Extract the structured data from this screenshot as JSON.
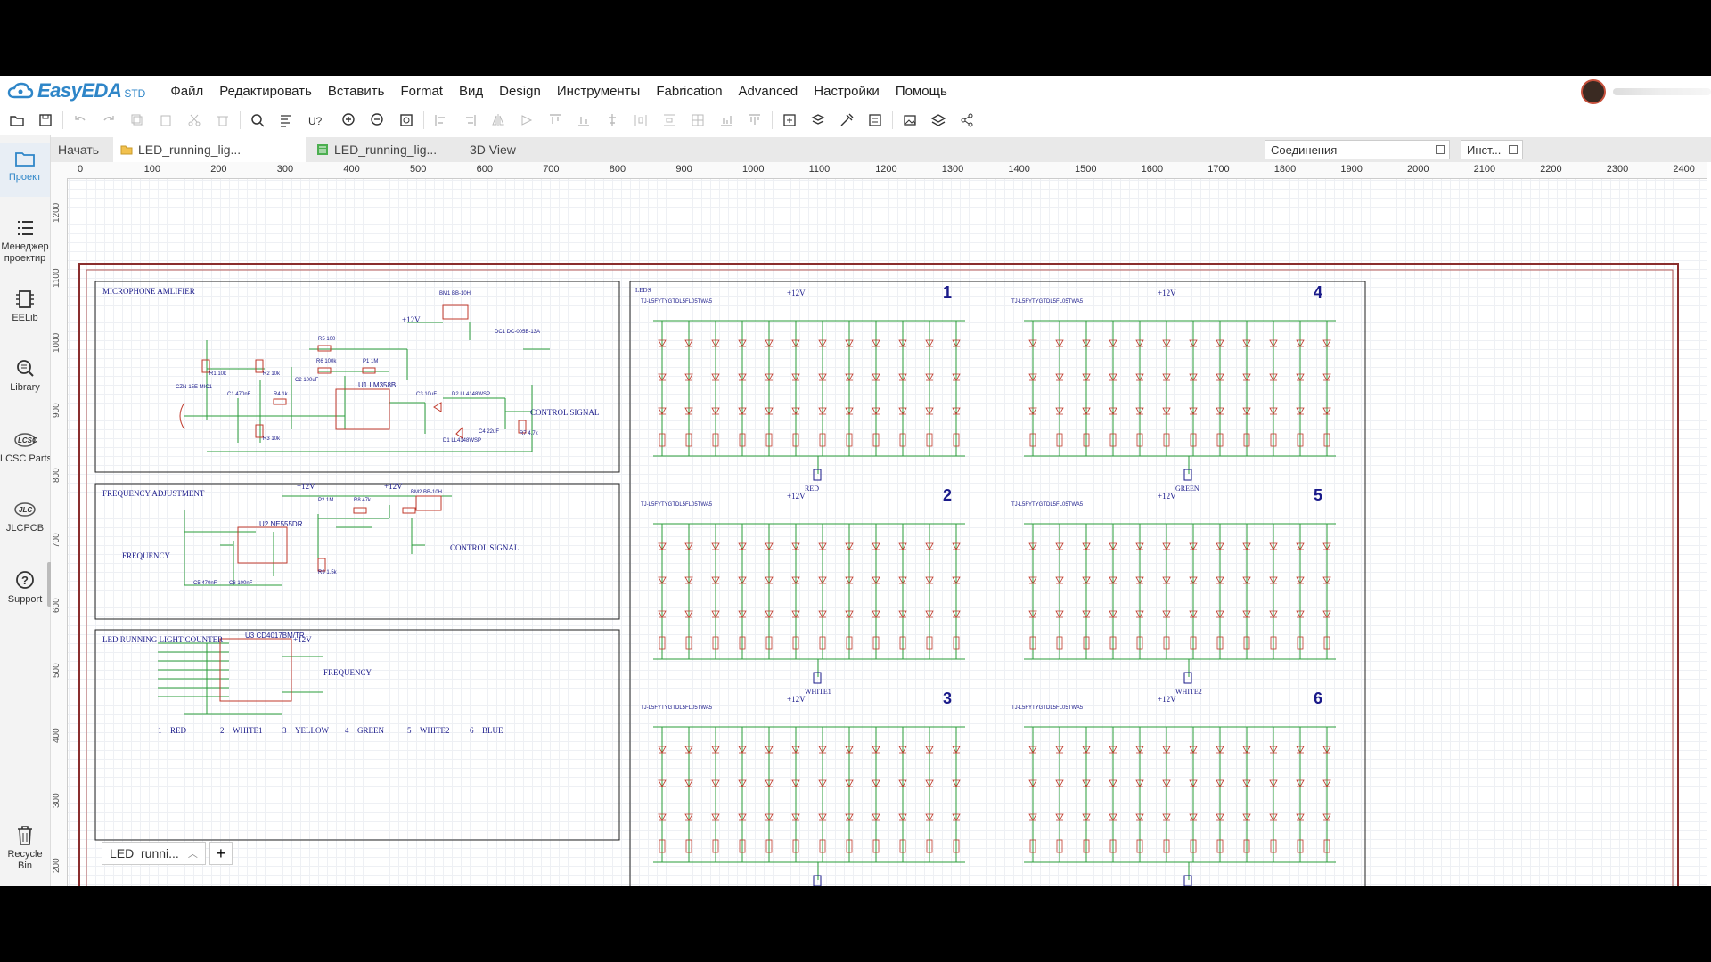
{
  "app": {
    "brand": "EasyEDA",
    "edition": "STD"
  },
  "menu": [
    "Файл",
    "Редактировать",
    "Вставить",
    "Format",
    "Вид",
    "Design",
    "Инструменты",
    "Fabrication",
    "Advanced",
    "Настройки",
    "Помощь"
  ],
  "sidebar": {
    "items": [
      {
        "label": "Проект",
        "icon": "folder-icon"
      },
      {
        "label": "Менеджер проектир",
        "icon": "list-icon"
      },
      {
        "label": "EELib",
        "icon": "component-icon"
      },
      {
        "label": "Library",
        "icon": "search-library-icon"
      },
      {
        "label": "LCSC Parts",
        "icon": "lcsc-icon"
      },
      {
        "label": "JLCPCB",
        "icon": "jlc-icon"
      },
      {
        "label": "Support",
        "icon": "help-icon"
      },
      {
        "label": "Recycle Bin",
        "icon": "trash-icon"
      }
    ]
  },
  "tabs": {
    "start": "Начать",
    "schematic": "LED_running_lig...",
    "pcb": "LED_running_lig...",
    "view3d": "3D View",
    "panel_connections": "Соединения",
    "panel_tools": "Инст..."
  },
  "ruler": {
    "top": [
      "0",
      "100",
      "200",
      "300",
      "400",
      "500",
      "600",
      "700",
      "800",
      "900",
      "1000",
      "1100",
      "1200",
      "1300",
      "1400",
      "1500",
      "1600",
      "1700",
      "1800",
      "1900",
      "2000",
      "2100",
      "2200",
      "2300",
      "2400"
    ],
    "left": [
      "1200",
      "1100",
      "1000",
      "900",
      "800",
      "700",
      "600",
      "500",
      "400",
      "300",
      "200"
    ]
  },
  "schematic": {
    "blocks": {
      "mic": "MICROPHONE AMLIFIER",
      "freq": "FREQUENCY ADJUSTMENT",
      "counter": "LED RUNNING LIGHT COUNTER",
      "leds": "LEDS"
    },
    "nets": {
      "control_signal": "CONTROL SIGNAL",
      "frequency": "FREQUENCY",
      "p12v": "+12V"
    },
    "channels": [
      {
        "num": "1",
        "name": "RED"
      },
      {
        "num": "2",
        "name": "WHITE1"
      },
      {
        "num": "3",
        "name": "YELLOW"
      },
      {
        "num": "4",
        "name": "GREEN"
      },
      {
        "num": "5",
        "name": "WHITE2"
      },
      {
        "num": "6",
        "name": "BLUE"
      }
    ],
    "counter_outputs": [
      {
        "num": "1",
        "name": "RED"
      },
      {
        "num": "2",
        "name": "WHITE1"
      },
      {
        "num": "3",
        "name": "YELLOW"
      },
      {
        "num": "4",
        "name": "GREEN"
      },
      {
        "num": "5",
        "name": "WHITE2"
      },
      {
        "num": "6",
        "name": "BLUE"
      }
    ],
    "chips": {
      "u1": "U1 LM358B",
      "u2": "U2 NE555DR",
      "u3": "U3 CD4017BM/TR"
    },
    "parts": {
      "bm1": "BM1 BB-10H",
      "bm2": "BM2 BB-10H",
      "dc1": "DC1 DC-005B-13A",
      "mic1": "CZN-15E MIC1",
      "d1": "D1 LL4148WSP",
      "d2": "D2 LL4148WSP",
      "r1": "R1 10k",
      "r2": "R2 10k",
      "r3": "R3 10k",
      "r4": "R4 1k",
      "r5": "R5 100",
      "r6": "R6 100k",
      "r7": "R7 4.7k",
      "r8": "R8 47k",
      "r9": "R9 1.5k",
      "p1": "P1 1M",
      "p2": "P2 1M",
      "c1": "C1 470nF",
      "c2": "C2 100uF",
      "c3": "C3 10uF",
      "c4": "C4 22uF",
      "c5": "C5 470nF",
      "c6": "C6 100nF"
    },
    "led_part": "TJ-L5FYTYGTDL5FL05TWA5"
  },
  "sheet_tab": "LED_runni...",
  "colors": {
    "accent": "#2f86c8",
    "wire": "#2a9d3a",
    "part": "#c0392b",
    "text": "#1a1a8a",
    "border": "#8a2e2e"
  }
}
